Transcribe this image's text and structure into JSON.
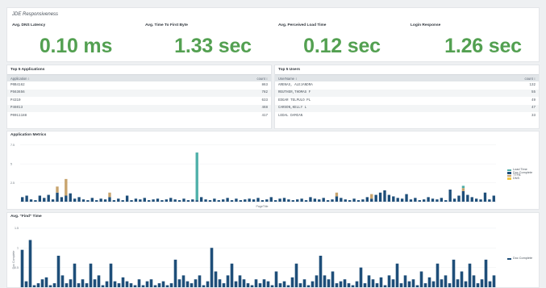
{
  "responsiveness": {
    "title": "JDE Responsiveness",
    "kpis": [
      {
        "label": "Avg. DNS Latency",
        "value": "0.10 ms"
      },
      {
        "label": "Avg. Time To First Byte",
        "value": "1.33 sec"
      },
      {
        "label": "Avg. Perceived Load Time",
        "value": "0.12 sec"
      },
      {
        "label": "Login Response",
        "value": "1.26 sec"
      }
    ]
  },
  "top_applications": {
    "title": "Top 5 Applications",
    "columns": [
      "Application ↕",
      "count ↕"
    ],
    "rows": [
      [
        "P0B4162",
        "863"
      ],
      [
        "P563656",
        "782"
      ],
      [
        "P4310",
        "633"
      ],
      [
        "P46013",
        "468"
      ],
      [
        "P0011188",
        "417"
      ]
    ]
  },
  "top_users": {
    "title": "Top 5 Users",
    "columns": [
      "UserName ↕",
      "count ↕"
    ],
    "rows": [
      [
        "ARENAS, ALEJANDRA",
        "132"
      ],
      [
        "REUTHER,THOMAS F",
        "55"
      ],
      [
        "EDGAR TELPULO PL",
        "49"
      ],
      [
        "CARSON,KELLY L",
        "47"
      ],
      [
        "LEDAL DAMIAN",
        "33"
      ]
    ]
  },
  "chart_data": [
    {
      "type": "bar",
      "title": "Application Metrics",
      "xlabel": "PageTitle",
      "ylim": [
        0,
        8
      ],
      "yticks": [
        "7.5",
        "5",
        "2.5"
      ],
      "legend_position": "right",
      "series": [
        {
          "name": "Load Time",
          "color": "#4fb0a9"
        },
        {
          "name": "Doc Complete",
          "color": "#1e4e79"
        },
        {
          "name": "TTFB",
          "color": "#c8a46e"
        },
        {
          "name": "DNS",
          "color": "#f2c744"
        }
      ],
      "values": {
        "doc_complete": [
          0.6,
          0.8,
          0.3,
          0.2,
          0.8,
          0.5,
          0.9,
          0.3,
          1.2,
          0.6,
          0.8,
          1.1,
          0.4,
          0.6,
          0.3,
          0.2,
          0.5,
          0.2,
          0.4,
          0.3,
          0.6,
          0.2,
          0.4,
          0.2,
          0.8,
          0.2,
          0.4,
          0.3,
          0.5,
          0.2,
          0.3,
          0.4,
          0.2,
          0.3,
          0.5,
          0.3,
          0.2,
          0.4,
          0.2,
          0.3,
          0.2,
          0.6,
          0.3,
          0.2,
          0.4,
          0.2,
          0.3,
          0.5,
          0.2,
          0.4,
          0.2,
          0.3,
          0.4,
          0.3,
          0.5,
          0.2,
          0.3,
          0.6,
          0.2,
          0.4,
          0.5,
          0.3,
          0.2,
          0.3,
          0.4,
          0.2,
          0.6,
          0.4,
          0.3,
          0.5,
          0.2,
          0.3,
          0.7,
          0.5,
          0.3,
          0.2,
          0.4,
          0.2,
          0.3,
          0.6,
          0.4,
          0.9,
          1.2,
          1.5,
          0.9,
          0.7,
          0.5,
          0.4,
          1.0,
          0.3,
          0.5,
          0.2,
          0.3,
          0.6,
          0.4,
          0.3,
          0.5,
          0.2,
          1.6,
          0.4,
          0.8,
          1.4,
          0.9,
          0.6,
          0.4,
          0.3,
          1.2,
          0.3,
          0.8
        ],
        "ttfb": [
          0,
          0,
          0,
          0,
          0,
          0,
          0,
          0,
          0.8,
          0,
          2.2,
          0,
          0,
          0,
          0,
          0,
          0,
          0,
          0,
          0,
          0.6,
          0,
          0,
          0,
          0,
          0,
          0,
          0,
          0,
          0,
          0,
          0,
          0,
          0,
          0,
          0,
          0,
          0,
          0,
          0,
          0,
          0,
          0,
          0,
          0,
          0,
          0,
          0,
          0,
          0,
          0,
          0,
          0,
          0,
          0,
          0,
          0,
          0,
          0,
          0,
          0,
          0,
          0,
          0,
          0,
          0,
          0,
          0,
          0,
          0,
          0,
          0,
          0.5,
          0,
          0,
          0,
          0,
          0,
          0,
          0,
          0.6,
          0,
          0,
          0,
          0,
          0,
          0,
          0,
          0,
          0,
          0,
          0,
          0,
          0,
          0,
          0,
          0,
          0,
          0,
          0,
          0,
          0.4,
          0,
          0,
          0,
          0,
          0,
          0,
          0
        ],
        "load_time": [
          0,
          0,
          0,
          0,
          0,
          0,
          0,
          0,
          0,
          0,
          0,
          0,
          0,
          0,
          0,
          0,
          0,
          0,
          0,
          0,
          0,
          0,
          0,
          0,
          0,
          0,
          0,
          0,
          0,
          0,
          0,
          0,
          0,
          0,
          0,
          0,
          0,
          0,
          0,
          0,
          6.3,
          0,
          0,
          0,
          0,
          0,
          0,
          0,
          0,
          0,
          0,
          0,
          0,
          0,
          0,
          0,
          0,
          0,
          0,
          0,
          0,
          0,
          0,
          0,
          0,
          0,
          0,
          0,
          0,
          0,
          0,
          0,
          0,
          0,
          0,
          0,
          0,
          0,
          0,
          0,
          0,
          0,
          0,
          0,
          0,
          0,
          0,
          0,
          0,
          0,
          0,
          0,
          0,
          0,
          0,
          0,
          0,
          0,
          0,
          0,
          0,
          0.3,
          0,
          0,
          0,
          0,
          0,
          0,
          0
        ]
      }
    },
    {
      "type": "bar",
      "title": "Avg. \"Find\" Time",
      "ylabel": "Doc Complete",
      "ylim": [
        0,
        1.6
      ],
      "yticks": [
        "1.5",
        "1",
        "0.5"
      ],
      "legend_position": "right",
      "series": [
        {
          "name": "Doc Complete",
          "color": "#1e4e79"
        }
      ],
      "values": [
        0.95,
        0.15,
        1.2,
        0.05,
        0.1,
        0.2,
        0.25,
        0.05,
        0.1,
        0.8,
        0.3,
        0.1,
        0.2,
        0.6,
        0.1,
        0.2,
        0.1,
        0.6,
        0.2,
        0.3,
        0.05,
        0.15,
        0.6,
        0.15,
        0.1,
        0.25,
        0.15,
        0.1,
        0.05,
        0.2,
        0.05,
        0.15,
        0.2,
        0.05,
        0.1,
        0.15,
        0.05,
        0.1,
        0.7,
        0.2,
        0.3,
        0.15,
        0.1,
        0.2,
        0.3,
        0.05,
        0.15,
        1.0,
        0.4,
        0.2,
        0.1,
        0.3,
        0.6,
        0.15,
        0.3,
        0.2,
        0.1,
        0.05,
        0.2,
        0.1,
        0.2,
        0.15,
        0.05,
        0.4,
        0.1,
        0.15,
        0.05,
        0.25,
        0.6,
        0.1,
        0.2,
        0.05,
        0.15,
        0.3,
        0.8,
        0.3,
        0.2,
        0.4,
        0.1,
        0.15,
        0.2,
        0.1,
        0.05,
        0.15,
        0.5,
        0.1,
        0.3,
        0.2,
        0.1,
        0.25,
        0.05,
        0.3,
        0.2,
        0.6,
        0.1,
        0.3,
        0.15,
        0.2,
        0.05,
        0.4,
        0.1,
        0.25,
        0.15,
        0.6,
        0.2,
        0.3,
        0.1,
        0.7,
        0.2,
        0.4,
        0.15,
        0.6,
        0.3,
        0.1,
        0.2,
        0.7,
        0.15,
        0.3
      ]
    }
  ]
}
